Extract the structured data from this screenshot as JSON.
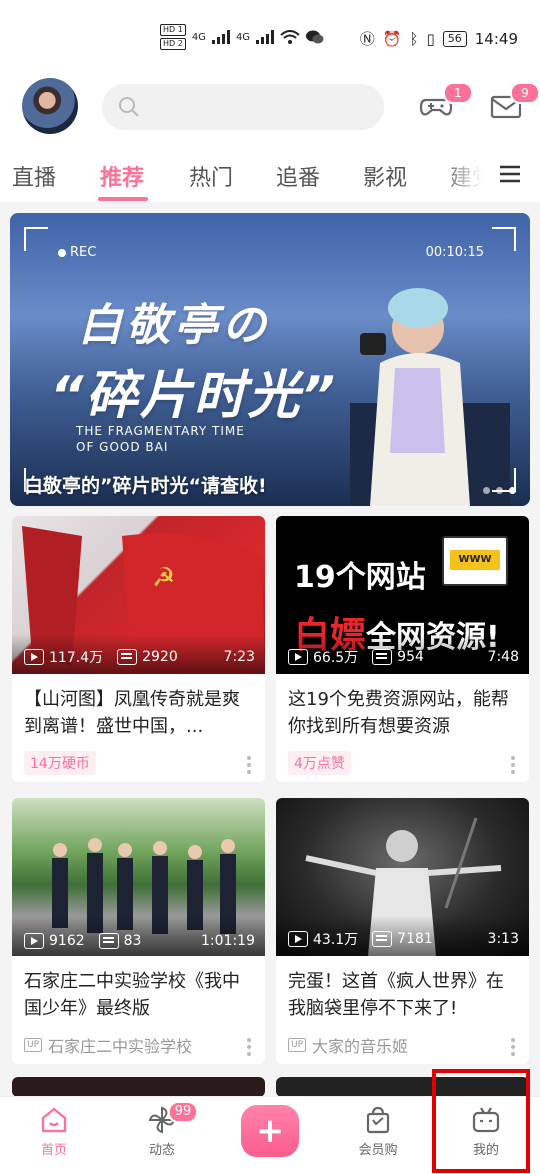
{
  "status_bar": {
    "hd1": "HD 1",
    "hd2": "HD 2",
    "signal_a": "4G",
    "signal_b": "4G",
    "battery": "56",
    "time": "14:49"
  },
  "header": {
    "search_placeholder": "",
    "game_badge": "1",
    "mail_badge": "9"
  },
  "tabs": [
    "直播",
    "推荐",
    "热门",
    "追番",
    "影视",
    "建党"
  ],
  "active_tab": "推荐",
  "banner": {
    "rec_label": "REC",
    "timer": "00:10:15",
    "title_line1": "白敬亭の",
    "title_line2": "“碎片时光”",
    "english_line1": "THE FRAGMENTARY TIME",
    "english_line2": "OF GOOD BAI",
    "caption": "白敬亭的”碎片时光“请查收!"
  },
  "cards": [
    {
      "views": "117.4万",
      "danmaku": "2920",
      "duration": "7:23",
      "title": "【山河图】凤凰传奇就是爽到离谱！盛世中国，...",
      "tag": "14万硬币"
    },
    {
      "views": "66.5万",
      "danmaku": "954",
      "duration": "7:48",
      "thumb_text1": "19个网站",
      "thumb_text2": "白嫖",
      "thumb_text3": "全网资源!",
      "thumb_www": "WWW",
      "title": "这19个免费资源网站，能帮你找到所有想要资源",
      "tag": "4万点赞"
    },
    {
      "views": "9162",
      "danmaku": "83",
      "duration": "1:01:19",
      "title": "石家庄二中实验学校《我中国少年》最终版",
      "up_label": "UP",
      "uploader": "石家庄二中实验学校"
    },
    {
      "views": "43.1万",
      "danmaku": "7181",
      "duration": "3:13",
      "title": "完蛋！这首《疯人世界》在我脑袋里停不下来了!",
      "up_label": "UP",
      "uploader": "大家的音乐姬"
    }
  ],
  "bottom_nav": {
    "home": "首页",
    "dynamic": "动态",
    "dynamic_badge": "99",
    "plus": "+",
    "vip": "会员购",
    "mine": "我的"
  },
  "colors": {
    "accent": "#fb7299",
    "highlight_box": "#e10000"
  }
}
